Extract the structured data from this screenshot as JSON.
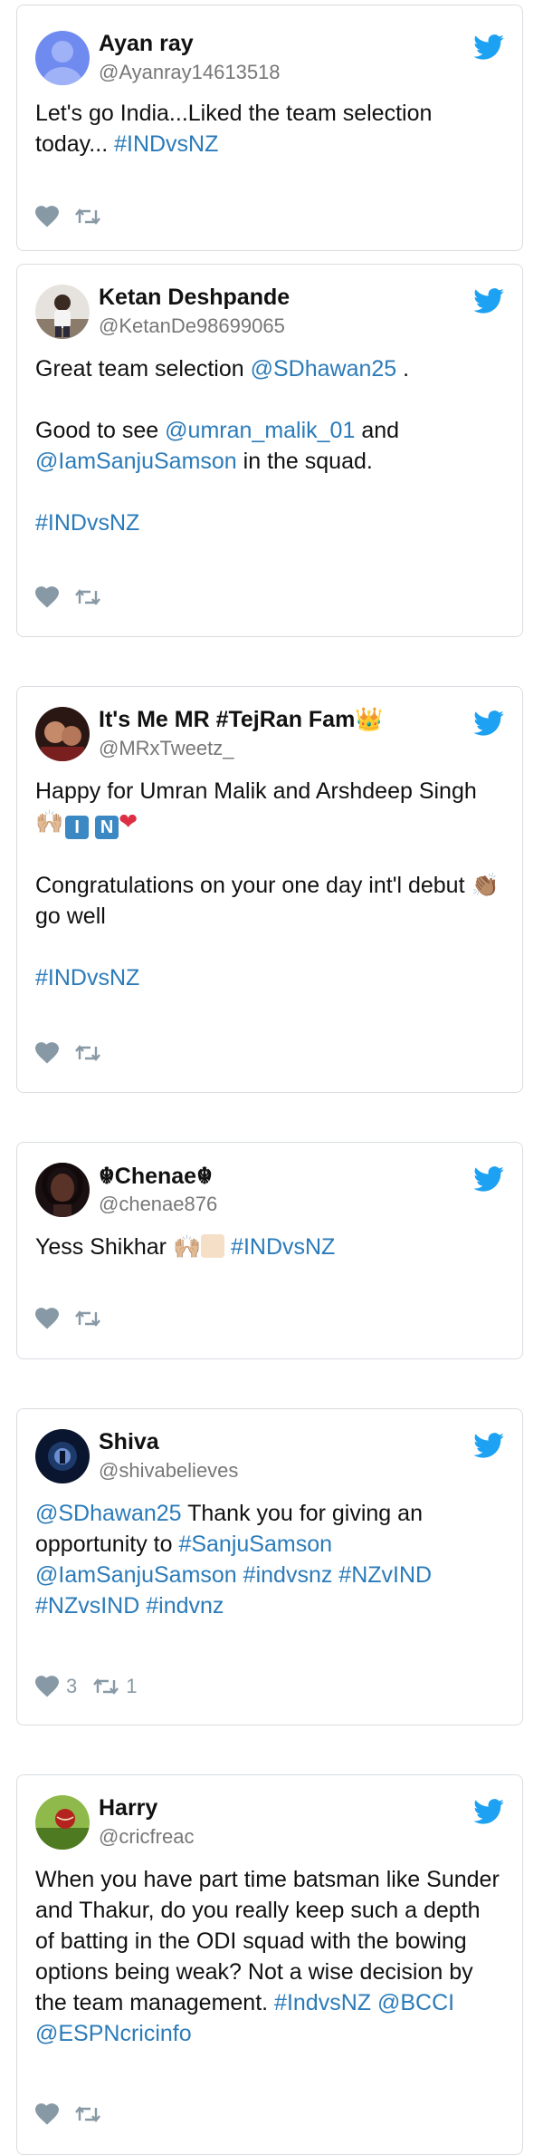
{
  "tweets": [
    {
      "name": "Ayan ray",
      "handle": "@Ayanray14613518",
      "text": "Let's go India...Liked the team selection today...",
      "hashtag": "#INDvsNZ"
    },
    {
      "name": "Ketan Deshpande",
      "handle": "@KetanDe98699065",
      "line1_pre": "Great team selection",
      "line1_mention": "@SDhawan25",
      "line1_post": ".",
      "line2_pre": "Good to see",
      "line2_mention1": "@umran_malik_01",
      "line2_mid": "and",
      "line2_mention2": "@IamSanjuSamson",
      "line2_post": "in the squad.",
      "hashtag": "#INDvsNZ"
    },
    {
      "name": "It's Me MR #TejRan Fam",
      "handle": "@MRxTweetz_",
      "line1": "Happy for Umran Malik and Arshdeep Singh",
      "emoji_i": "I",
      "emoji_n": "N",
      "line2_pre": "Congratulations on your one day int'l debut",
      "line2_post": "go well",
      "hashtag": "#INDvsNZ"
    },
    {
      "name": "Chenae",
      "handle": "@chenae876",
      "text": "Yess Shikhar",
      "hashtag": "#INDvsNZ"
    },
    {
      "name": "Shiva",
      "handle": "@shivabelieves",
      "mention": "@SDhawan25",
      "text1": "Thank you for giving an opportunity to",
      "tag1": "#SanjuSamson",
      "mention2": "@IamSanjuSamson",
      "tag2": "#indvsnz",
      "tag3": "#NZvIND",
      "tag4": "#NZvsIND",
      "tag5": "#indvnz",
      "likes": "3",
      "retweets": "1"
    },
    {
      "name": "Harry",
      "handle": "@cricfreac",
      "text": "When you have part time batsman like Sunder and Thakur, do you really keep such a depth of batting in the ODI squad with the bowing options being weak? Not a wise decision by the team management.",
      "tag1": "#IndvsNZ",
      "mention1": "@BCCI",
      "mention2": "@ESPNcricinfo"
    }
  ],
  "colors": {
    "link": "#2b7bb9",
    "bird": "#1da1f2",
    "action": "#8899a6",
    "border": "#d9dde1"
  },
  "icons": {
    "brand": "twitter-bird-icon",
    "like": "heart-icon",
    "retweet": "retweet-icon"
  }
}
